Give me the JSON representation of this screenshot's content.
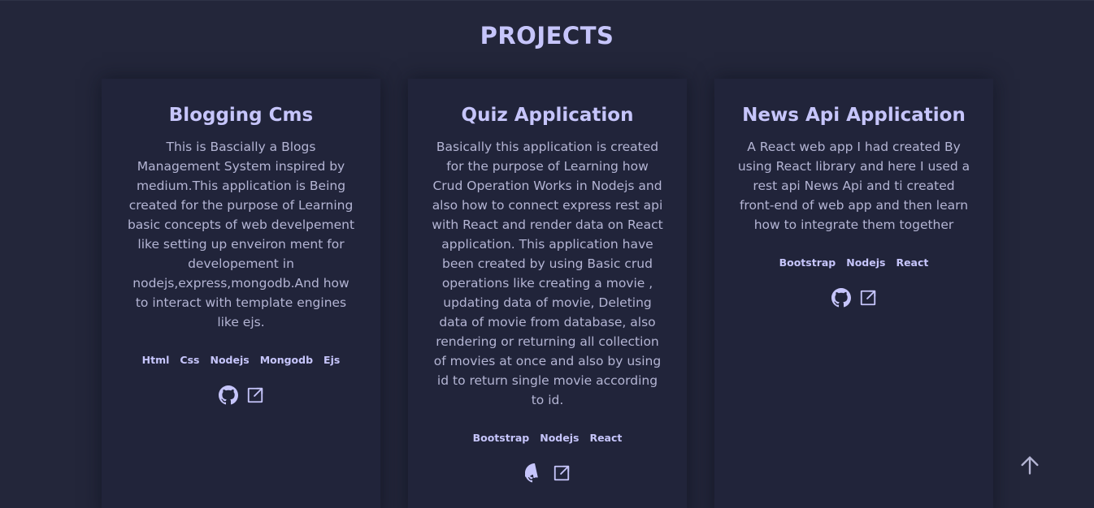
{
  "section": {
    "title": "PROJECTS"
  },
  "projects": [
    {
      "title": "Blogging Cms",
      "description": "This is Bascially a Blogs Management System inspired by medium.This application is Being created for the purpose of Learning basic concepts of web develpement like setting up enveiron ment for developement in nodejs,express,mongodb.And how to interact with template engines like ejs.",
      "tags": [
        "Html",
        "Css",
        "Nodejs",
        "Mongodb",
        "Ejs"
      ],
      "links": [
        {
          "icon": "github-icon"
        },
        {
          "icon": "external-link-icon"
        }
      ]
    },
    {
      "title": "Quiz Application",
      "description": "Basically this application is created for the purpose of Learning how Crud Operation Works in Nodejs and also how to connect express rest api with React and render data on React application. This application have been created by using Basic crud operations like creating a movie , updating data of movie, Deleting data of movie from database, also rendering or returning all collection of movies at once and also by using id to return single movie according to id.",
      "tags": [
        "Bootstrap",
        "Nodejs",
        "React"
      ],
      "links": [
        {
          "icon": "github-icon"
        },
        {
          "icon": "external-link-icon"
        }
      ]
    },
    {
      "title": "News Api Application",
      "description": "A React web app I had created By using React library and here I used a rest api News Api and ti created front-end of web app and then learn how to integrate them together",
      "tags": [
        "Bootstrap",
        "Nodejs",
        "React"
      ],
      "links": [
        {
          "icon": "github-icon"
        },
        {
          "icon": "external-link-icon"
        }
      ]
    }
  ],
  "scroll_top": {
    "icon": "arrow-up-icon"
  },
  "colors": {
    "background": "#23263a",
    "card": "#21243a",
    "accent": "#c6c5fb",
    "text": "#b4b5d4"
  }
}
